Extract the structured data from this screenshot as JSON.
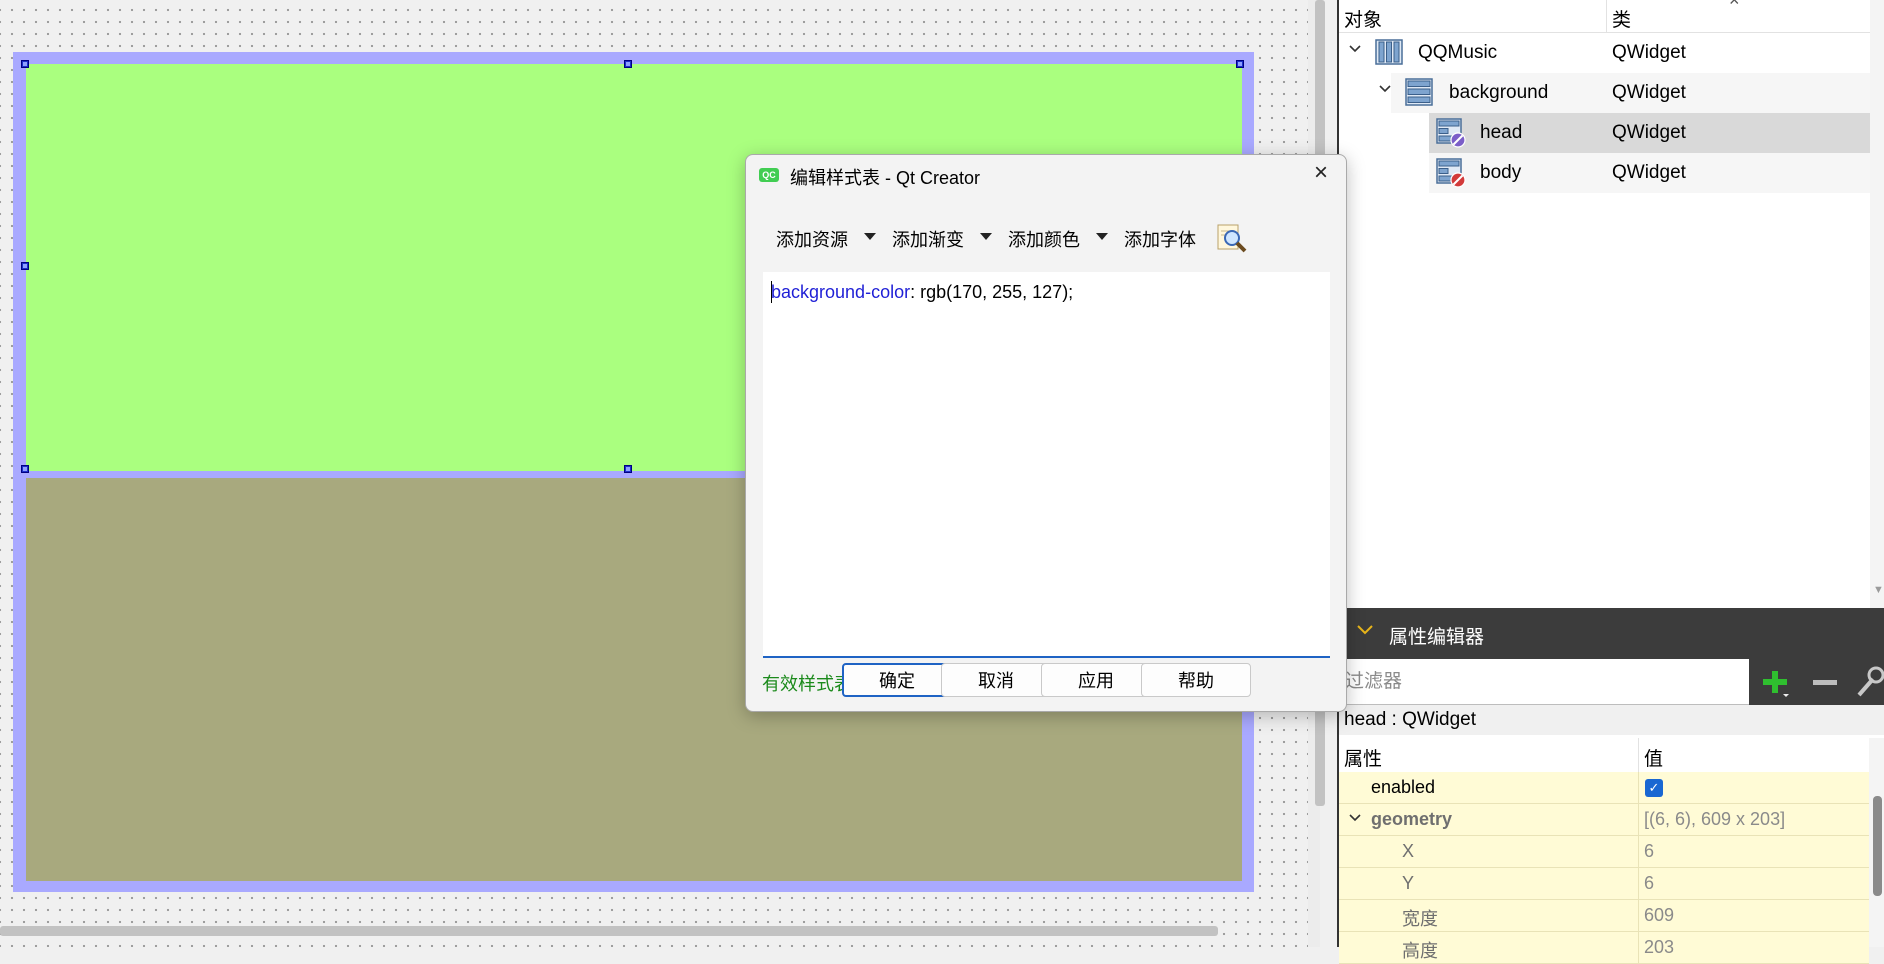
{
  "dialog": {
    "title": "编辑样式表 - Qt Creator",
    "icon_label": "QC",
    "toolbar": {
      "add_resource": "添加资源",
      "add_gradient": "添加渐变",
      "add_color": "添加颜色",
      "add_font": "添加字体"
    },
    "stylesheet": {
      "property": "background-color",
      "value": ": rgb(170, 255, 127);"
    },
    "status": "有效样式表",
    "buttons": {
      "ok": "确定",
      "cancel": "取消",
      "apply": "应用",
      "help": "帮助"
    }
  },
  "object_inspector": {
    "col_object": "对象",
    "col_class": "类",
    "rows": [
      {
        "name": "QQMusic",
        "class": "QWidget",
        "icon": "widget-columns-icon"
      },
      {
        "name": "background",
        "class": "QWidget",
        "icon": "widget-rows-icon"
      },
      {
        "name": "head",
        "class": "QWidget",
        "icon": "widget-broken-layout-icon"
      },
      {
        "name": "body",
        "class": "QWidget",
        "icon": "widget-broken-layout-icon"
      }
    ]
  },
  "property_editor": {
    "title": "属性编辑器",
    "filter_placeholder": "过滤器",
    "object_label": "head : QWidget",
    "col_property": "属性",
    "col_value": "值",
    "rows": [
      {
        "name": "enabled",
        "value": ""
      },
      {
        "name": "geometry",
        "value": "[(6, 6), 609 x 203]"
      },
      {
        "name": "X",
        "value": "6"
      },
      {
        "name": "Y",
        "value": "6"
      },
      {
        "name": "宽度",
        "value": "609"
      },
      {
        "name": "高度",
        "value": "203"
      }
    ]
  },
  "colors": {
    "head_bg": "#aaff7f",
    "body_bg": "#a8a97e",
    "selection_frame": "#a9a9ff",
    "accent": "#1f63c4"
  }
}
